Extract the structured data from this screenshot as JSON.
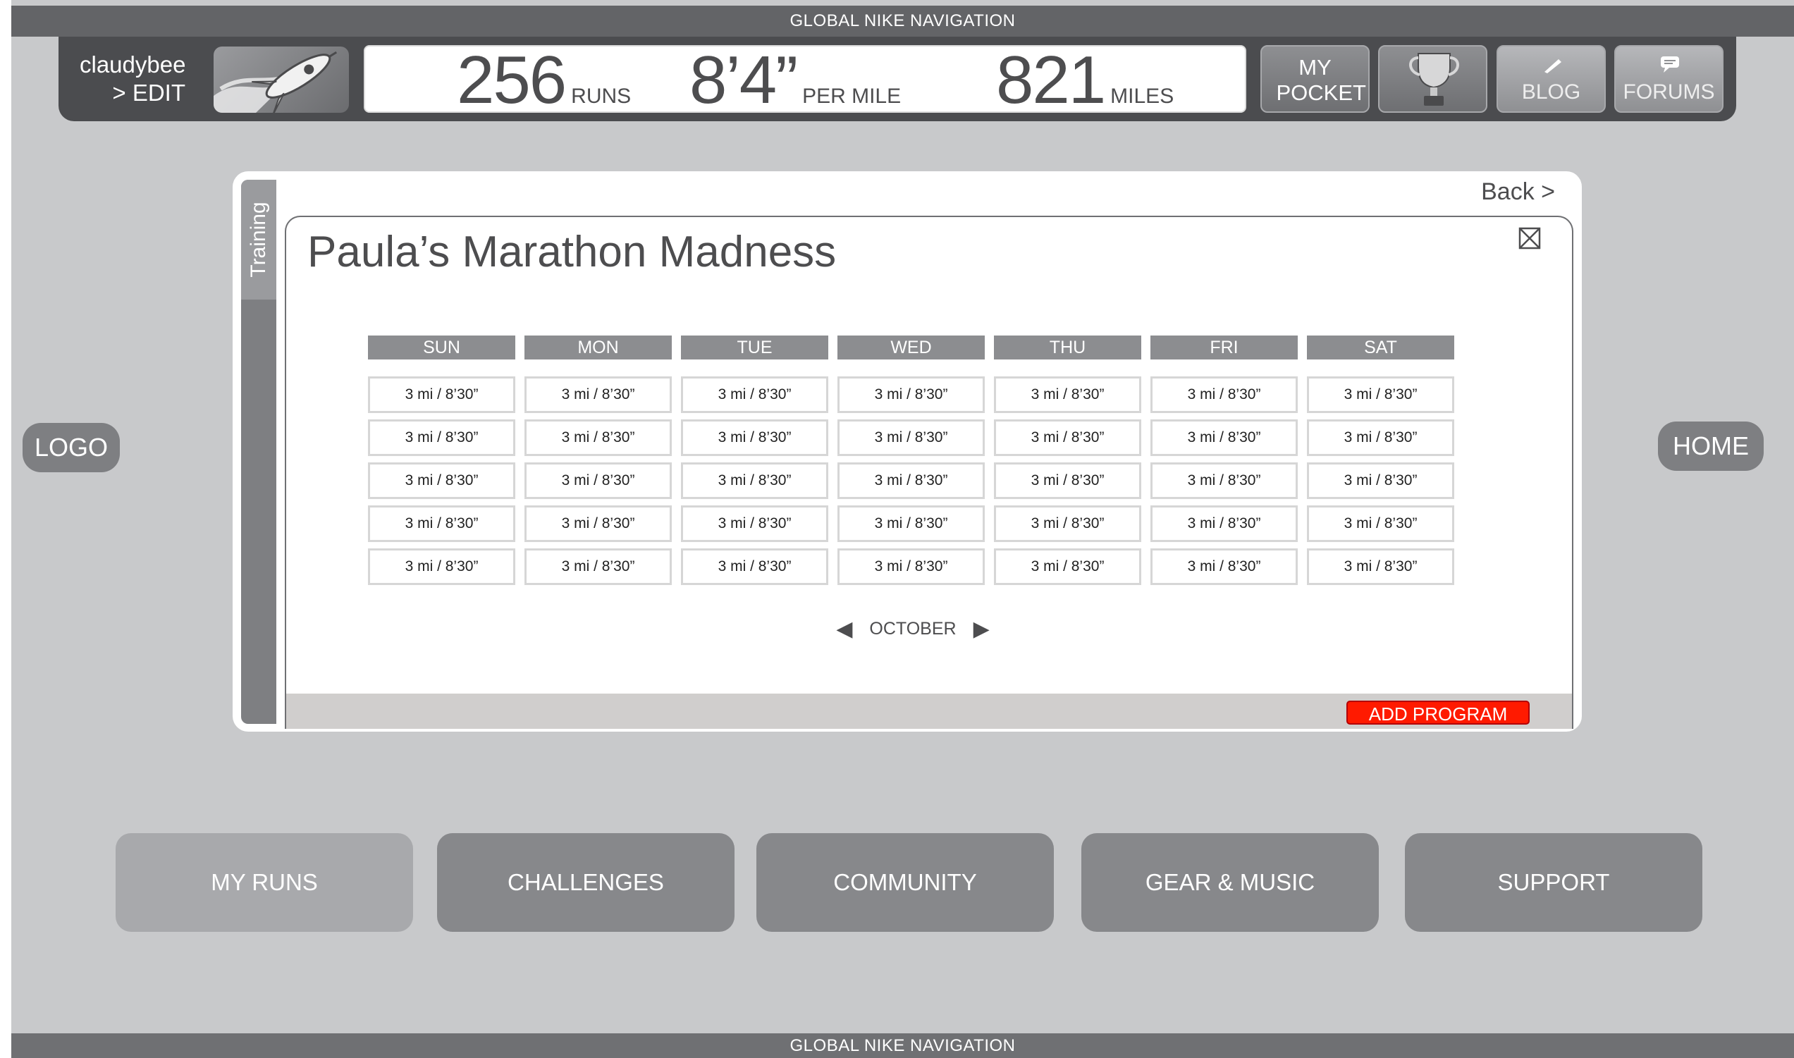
{
  "global_nav": {
    "top_label": "GLOBAL NIKE NAVIGATION",
    "bottom_label": "GLOBAL NIKE NAVIGATION"
  },
  "user_bar": {
    "username": "claudybee",
    "edit_link": "> EDIT",
    "avatar_icon": "rocket-icon",
    "stats": [
      {
        "value": "256",
        "unit": "RUNS"
      },
      {
        "value": "8’4”",
        "unit": "PER MILE"
      },
      {
        "value": "821",
        "unit": "MILES"
      }
    ],
    "buttons": {
      "my_pocket": "MY POCKET",
      "trophy_icon": "trophy-icon",
      "blog": "BLOG",
      "forums": "FORUMS"
    }
  },
  "side": {
    "logo": "LOGO",
    "home": "HOME"
  },
  "panel": {
    "tab_label": "Training",
    "back_link": "Back >",
    "program_title": "Paula’s Marathon Madness",
    "close_icon": "close-box-icon",
    "days": [
      "SUN",
      "MON",
      "TUE",
      "WED",
      "THU",
      "FRI",
      "SAT"
    ],
    "weeks": [
      [
        "3 mi / 8’30”",
        "3 mi / 8’30”",
        "3 mi / 8’30”",
        "3 mi / 8’30”",
        "3 mi / 8’30”",
        "3 mi / 8’30”",
        "3 mi / 8’30”"
      ],
      [
        "3 mi / 8’30”",
        "3 mi / 8’30”",
        "3 mi / 8’30”",
        "3 mi / 8’30”",
        "3 mi / 8’30”",
        "3 mi / 8’30”",
        "3 mi / 8’30”"
      ],
      [
        "3 mi / 8’30”",
        "3 mi / 8’30”",
        "3 mi / 8’30”",
        "3 mi / 8’30”",
        "3 mi / 8’30”",
        "3 mi / 8’30”",
        "3 mi / 8’30”"
      ],
      [
        "3 mi / 8’30”",
        "3 mi / 8’30”",
        "3 mi / 8’30”",
        "3 mi / 8’30”",
        "3 mi / 8’30”",
        "3 mi / 8’30”",
        "3 mi / 8’30”"
      ],
      [
        "3 mi / 8’30”",
        "3 mi / 8’30”",
        "3 mi / 8’30”",
        "3 mi / 8’30”",
        "3 mi / 8’30”",
        "3 mi / 8’30”",
        "3 mi / 8’30”"
      ]
    ],
    "month": "OCTOBER",
    "add_program": "ADD PROGRAM",
    "add_program_color": "#ff1a00"
  },
  "bottom_nav": {
    "items": [
      "MY RUNS",
      "CHALLENGES",
      "COMMUNITY",
      "GEAR & MUSIC",
      "SUPPORT"
    ],
    "active": "MY RUNS"
  }
}
